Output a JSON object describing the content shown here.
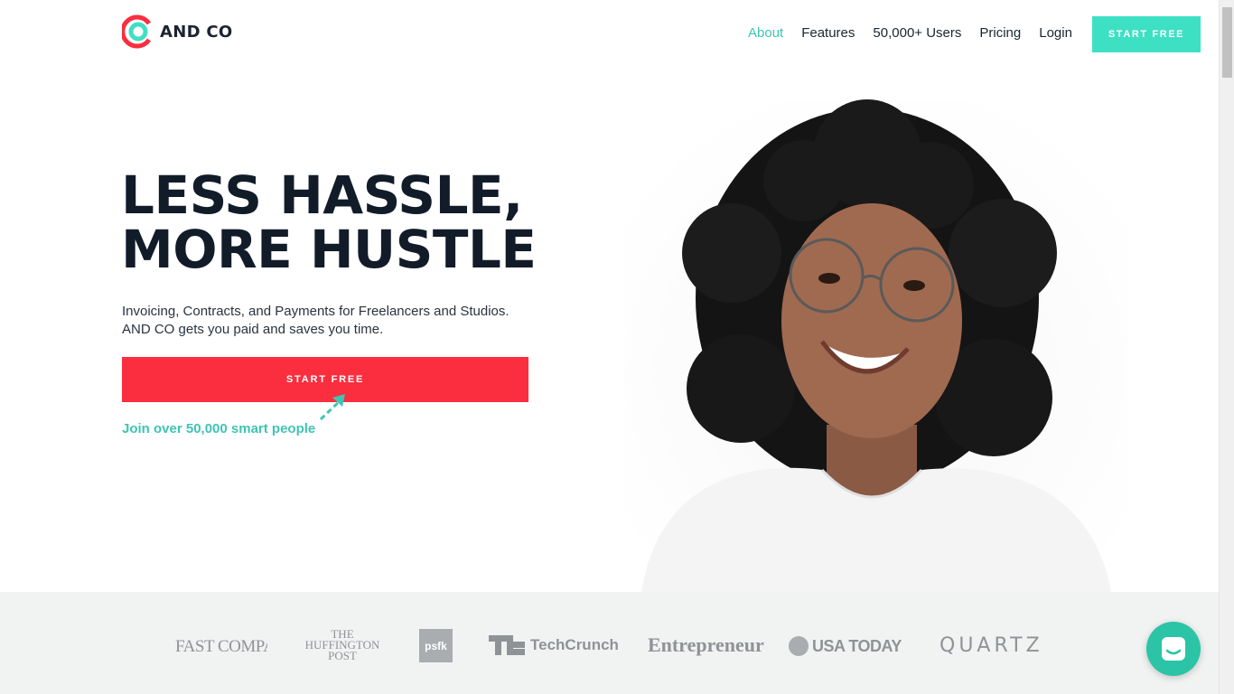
{
  "brand": {
    "name": "AND CO",
    "accent": "#3ee0c4",
    "primary_red": "#fa2e3f",
    "teal_text": "#3fc5b2"
  },
  "nav": {
    "items": [
      {
        "label": "About",
        "active": true
      },
      {
        "label": "Features",
        "active": false
      },
      {
        "label": "50,000+ Users",
        "active": false
      },
      {
        "label": "Pricing",
        "active": false
      },
      {
        "label": "Login",
        "active": false
      }
    ],
    "cta_label": "START FREE"
  },
  "hero": {
    "headline_line1": "LESS HASSLE,",
    "headline_line2": "MORE HUSTLE",
    "subtitle_line1": "Invoicing, Contracts, and Payments for Freelancers and Studios.",
    "subtitle_line2": "AND CO gets you paid and saves you time.",
    "cta_label": "START FREE",
    "join_text": "Join over 50,000 smart people"
  },
  "press": {
    "logos": [
      "FAST COMPANY",
      "THE HUFFINGTON POST",
      "psfk",
      "TechCrunch",
      "Entrepreneur",
      "USA TODAY",
      "QUARTZ"
    ]
  },
  "icons": {
    "logo": "and-co-logo-icon",
    "arrow": "arrow-icon",
    "chat": "chat-icon"
  }
}
